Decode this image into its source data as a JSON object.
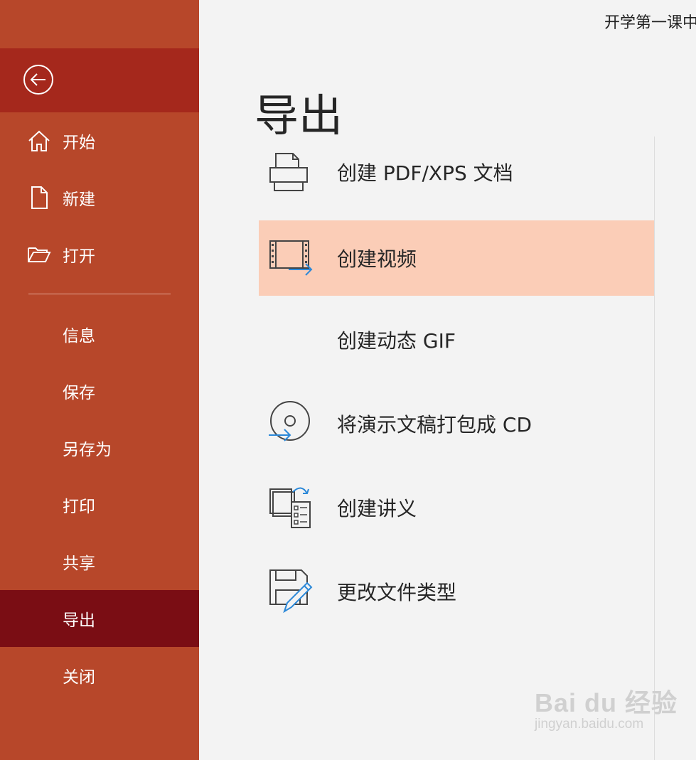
{
  "document_title": "开学第一课中",
  "page": {
    "title": "导出"
  },
  "sidebar": {
    "back_label": "back-arrow-icon",
    "top_items": [
      {
        "label": "开始",
        "icon": "home-icon"
      },
      {
        "label": "新建",
        "icon": "new-document-icon"
      },
      {
        "label": "打开",
        "icon": "open-folder-icon"
      }
    ],
    "items": [
      {
        "label": "信息"
      },
      {
        "label": "保存"
      },
      {
        "label": "另存为"
      },
      {
        "label": "打印"
      },
      {
        "label": "共享"
      },
      {
        "label": "导出",
        "active": true
      },
      {
        "label": "关闭"
      }
    ]
  },
  "export_options": [
    {
      "label": "创建 PDF/XPS 文档",
      "icon": "printer-pdf-icon"
    },
    {
      "label": "创建视频",
      "icon": "video-film-icon",
      "selected": true
    },
    {
      "label": "创建动态 GIF",
      "icon": ""
    },
    {
      "label": "将演示文稿打包成 CD",
      "icon": "cd-disc-icon"
    },
    {
      "label": "创建讲义",
      "icon": "handout-icon"
    },
    {
      "label": "更改文件类型",
      "icon": "save-edit-icon"
    }
  ],
  "watermark": {
    "main": "Bai du 经验",
    "sub": "jingyan.baidu.com"
  },
  "colors": {
    "sidebar_bg": "#b7472a",
    "back_row_bg": "#a5281c",
    "active_item_bg": "#7a0d14",
    "selected_option_bg": "#fbcdb7",
    "content_bg": "#f3f3f3"
  }
}
